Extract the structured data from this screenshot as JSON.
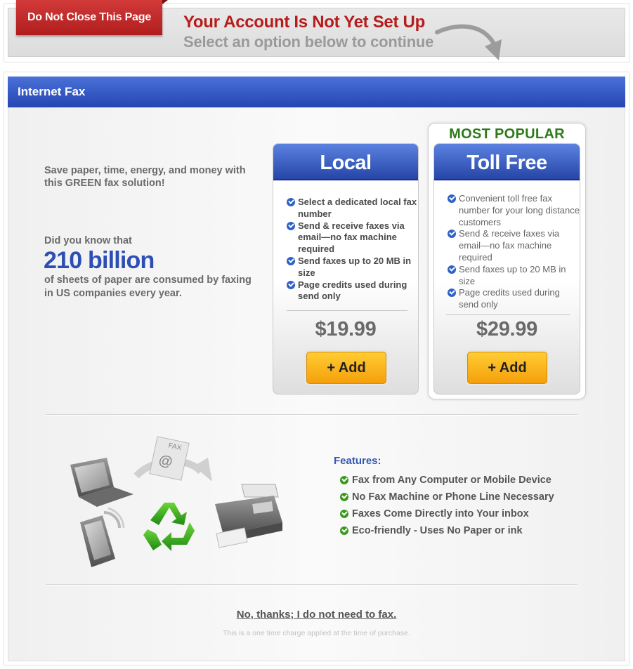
{
  "banner": {
    "tab_label": "Do Not Close This Page",
    "title": "Your Account Is Not Yet Set Up",
    "subtitle": "Select an option below to continue"
  },
  "section": {
    "title": "Internet Fax"
  },
  "pitch": {
    "line": "Save paper, time, energy, and money with this GREEN fax solution!",
    "did_you_know": "Did you know that",
    "big_number": "210 billion",
    "rest": "of sheets of paper are consumed by faxing in US companies every year."
  },
  "plans": {
    "popular_label": "MOST POPULAR",
    "local": {
      "name": "Local",
      "features": [
        "Select a dedicated local fax number",
        "Send & receive faxes via email—no fax machine required",
        "Send faxes up to 20 MB in size",
        "Page credits used during send only"
      ],
      "price": "$19.99",
      "button": "+ Add"
    },
    "toll_free": {
      "name": "Toll Free",
      "features": [
        "Convenient toll free fax number for your long distance customers",
        "Send & receive faxes via email—no fax machine required",
        "Send faxes up to 20 MB in size",
        "Page credits used during send only"
      ],
      "price": "$29.99",
      "button": "+ Add"
    }
  },
  "illustration": {
    "envelope_label": "FAX",
    "envelope_symbol": "@"
  },
  "features": {
    "title": "Features:",
    "items": [
      "Fax from Any Computer or Mobile Device",
      "No Fax Machine or Phone Line Necessary",
      "Faxes Come Directly into Your inbox",
      "Eco-friendly - Uses No Paper or ink"
    ]
  },
  "footer": {
    "decline_link": "No, thanks; I do not need to fax.",
    "fine_print": "This is a one time charge applied at the time of purchase."
  },
  "colors": {
    "tab_red": "#c02a2a",
    "title_red": "#b71c1c",
    "section_blue": "#2d4fb5",
    "popular_green": "#2e7a1a",
    "button_orange": "#f9b21f"
  }
}
